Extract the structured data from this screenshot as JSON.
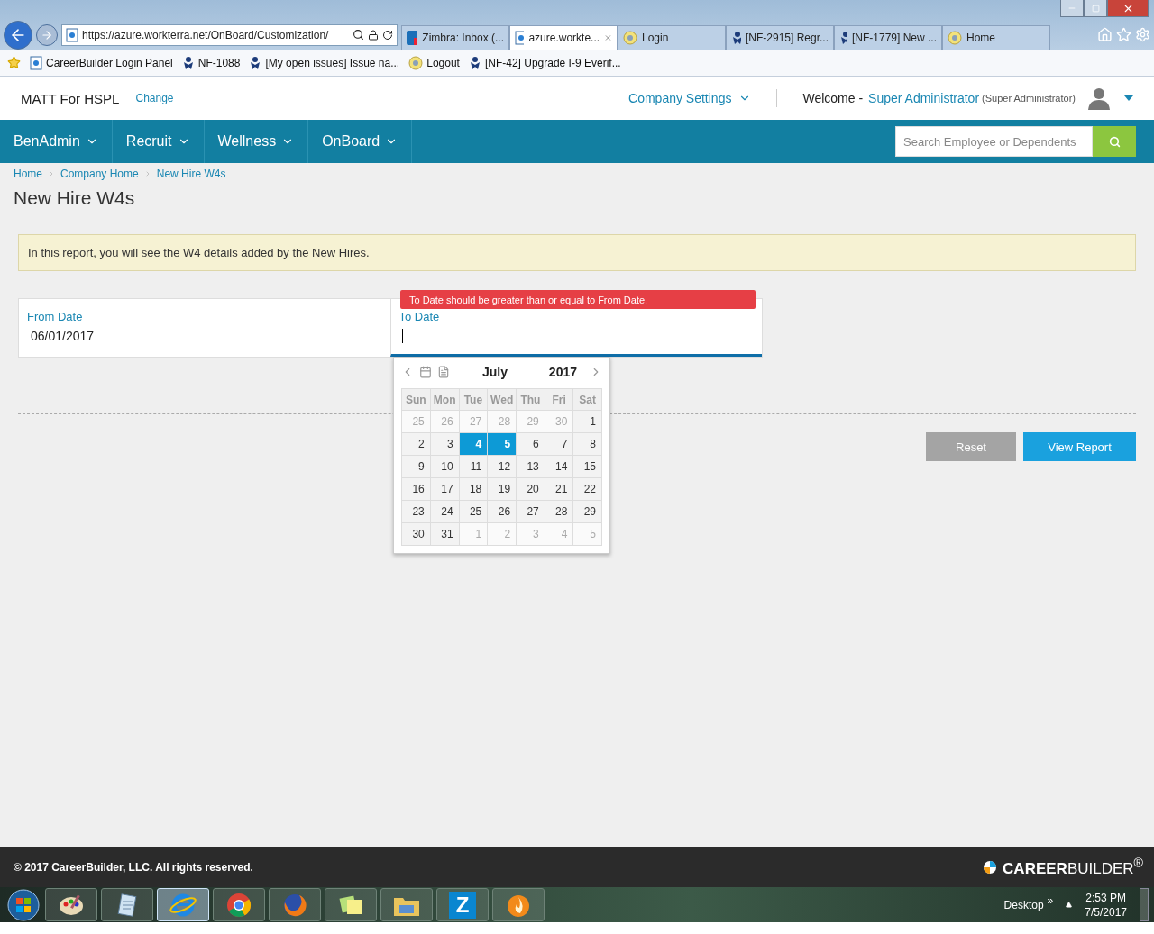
{
  "browser": {
    "url": "https://azure.workterra.net/OnBoard/Customization/",
    "tabs": [
      {
        "title": "Zimbra: Inbox (...",
        "kind": "zimbra",
        "selected": false
      },
      {
        "title": "azure.workte...",
        "kind": "page",
        "selected": true
      },
      {
        "title": "Login",
        "kind": "sun",
        "selected": false
      },
      {
        "title": "[NF-2915] Regr...",
        "kind": "jira",
        "selected": false
      },
      {
        "title": "[NF-1779] New ...",
        "kind": "jira",
        "selected": false
      },
      {
        "title": "Home",
        "kind": "sun",
        "selected": false
      }
    ],
    "favorites": [
      {
        "title": "CareerBuilder Login Panel",
        "kind": "page"
      },
      {
        "title": "NF-1088",
        "kind": "jira"
      },
      {
        "title": "[My open issues] Issue na...",
        "kind": "jira"
      },
      {
        "title": "Logout",
        "kind": "sun"
      },
      {
        "title": "[NF-42] Upgrade I-9 Everif...",
        "kind": "jira"
      }
    ]
  },
  "header": {
    "company": "MATT For HSPL",
    "change_link": "Change",
    "settings": "Company Settings",
    "welcome": "Welcome -",
    "user": "Super Administrator",
    "role": "(Super Administrator)"
  },
  "nav": {
    "items": [
      "BenAdmin",
      "Recruit",
      "Wellness",
      "OnBoard"
    ],
    "search": {
      "placeholder": "Search Employee or Dependents"
    }
  },
  "breadcrumb": [
    "Home",
    "Company Home",
    "New Hire W4s"
  ],
  "page_title": "New Hire W4s",
  "info": "In this report, you will see the W4 details added by the New Hires.",
  "form": {
    "from_label": "From Date",
    "from_value": "06/01/2017",
    "to_label": "To Date",
    "error": "To Date should be greater than or equal to From Date."
  },
  "calendar": {
    "month": "July",
    "year": "2017",
    "weekdays": [
      "Sun",
      "Mon",
      "Tue",
      "Wed",
      "Thu",
      "Fri",
      "Sat"
    ],
    "weeks": [
      [
        {
          "day": "25",
          "other_month": true,
          "selected": false
        },
        {
          "day": "26",
          "other_month": true,
          "selected": false
        },
        {
          "day": "27",
          "other_month": true,
          "selected": false
        },
        {
          "day": "28",
          "other_month": true,
          "selected": false
        },
        {
          "day": "29",
          "other_month": true,
          "selected": false
        },
        {
          "day": "30",
          "other_month": true,
          "selected": false
        },
        {
          "day": "1",
          "other_month": false,
          "selected": false
        }
      ],
      [
        {
          "day": "2",
          "other_month": false,
          "selected": false
        },
        {
          "day": "3",
          "other_month": false,
          "selected": false
        },
        {
          "day": "4",
          "other_month": false,
          "selected": true
        },
        {
          "day": "5",
          "other_month": false,
          "selected": true
        },
        {
          "day": "6",
          "other_month": false,
          "selected": false
        },
        {
          "day": "7",
          "other_month": false,
          "selected": false
        },
        {
          "day": "8",
          "other_month": false,
          "selected": false
        }
      ],
      [
        {
          "day": "9",
          "other_month": false,
          "selected": false
        },
        {
          "day": "10",
          "other_month": false,
          "selected": false
        },
        {
          "day": "11",
          "other_month": false,
          "selected": false
        },
        {
          "day": "12",
          "other_month": false,
          "selected": false
        },
        {
          "day": "13",
          "other_month": false,
          "selected": false
        },
        {
          "day": "14",
          "other_month": false,
          "selected": false
        },
        {
          "day": "15",
          "other_month": false,
          "selected": false
        }
      ],
      [
        {
          "day": "16",
          "other_month": false,
          "selected": false
        },
        {
          "day": "17",
          "other_month": false,
          "selected": false
        },
        {
          "day": "18",
          "other_month": false,
          "selected": false
        },
        {
          "day": "19",
          "other_month": false,
          "selected": false
        },
        {
          "day": "20",
          "other_month": false,
          "selected": false
        },
        {
          "day": "21",
          "other_month": false,
          "selected": false
        },
        {
          "day": "22",
          "other_month": false,
          "selected": false
        }
      ],
      [
        {
          "day": "23",
          "other_month": false,
          "selected": false
        },
        {
          "day": "24",
          "other_month": false,
          "selected": false
        },
        {
          "day": "25",
          "other_month": false,
          "selected": false
        },
        {
          "day": "26",
          "other_month": false,
          "selected": false
        },
        {
          "day": "27",
          "other_month": false,
          "selected": false
        },
        {
          "day": "28",
          "other_month": false,
          "selected": false
        },
        {
          "day": "29",
          "other_month": false,
          "selected": false
        }
      ],
      [
        {
          "day": "30",
          "other_month": false,
          "selected": false
        },
        {
          "day": "31",
          "other_month": false,
          "selected": false
        },
        {
          "day": "1",
          "other_month": true,
          "selected": false
        },
        {
          "day": "2",
          "other_month": true,
          "selected": false
        },
        {
          "day": "3",
          "other_month": true,
          "selected": false
        },
        {
          "day": "4",
          "other_month": true,
          "selected": false
        },
        {
          "day": "5",
          "other_month": true,
          "selected": false
        }
      ]
    ]
  },
  "buttons": [
    {
      "label": "Reset",
      "kind": "secondary"
    },
    {
      "label": "View Report",
      "kind": "primary"
    }
  ],
  "footer": {
    "copyright": "© 2017 CareerBuilder, LLC. All rights reserved.",
    "logo": "**CAREER**BUILDER$^{®}$"
  },
  "taskbar": {
    "apps": [
      {
        "kind": "paint",
        "selected": false
      },
      {
        "kind": "notepad",
        "selected": false
      },
      {
        "kind": "ie",
        "selected": true
      },
      {
        "kind": "chrome",
        "selected": false
      },
      {
        "kind": "firefox",
        "selected": false
      },
      {
        "kind": "sticky",
        "selected": false
      },
      {
        "kind": "explorer",
        "selected": false
      },
      {
        "kind": "zimbra",
        "label": "Z",
        "selected": false
      },
      {
        "kind": "flame",
        "selected": false
      }
    ],
    "desktop": "Desktop",
    "chevron": "»",
    "time": "2:53 PM",
    "date": "7/5/2017"
  }
}
